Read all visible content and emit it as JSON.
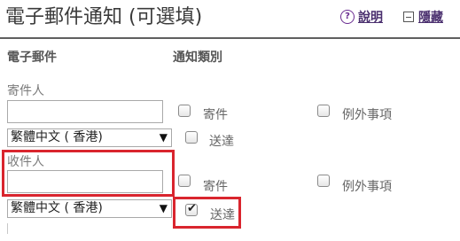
{
  "header": {
    "title": "電子郵件通知 (可選填)",
    "help_label": "說明",
    "hide_label": "隱藏"
  },
  "columns": {
    "email": "電子郵件",
    "notify_type": "通知類別"
  },
  "sender": {
    "label": "寄件人",
    "value": "",
    "language": "繁體中文 ( 香港)",
    "options": [
      {
        "label": "寄件",
        "checked": false
      },
      {
        "label": "例外事項",
        "checked": false
      },
      {
        "label": "送達",
        "checked": false
      }
    ]
  },
  "recipient": {
    "label": "收件人",
    "value": "",
    "language": "繁體中文 ( 香港)",
    "options": [
      {
        "label": "寄件",
        "checked": false
      },
      {
        "label": "例外事項",
        "checked": false
      },
      {
        "label": "送達",
        "checked": true
      }
    ]
  },
  "colors": {
    "highlight": "#d9252e",
    "link": "#4a2f6e"
  }
}
